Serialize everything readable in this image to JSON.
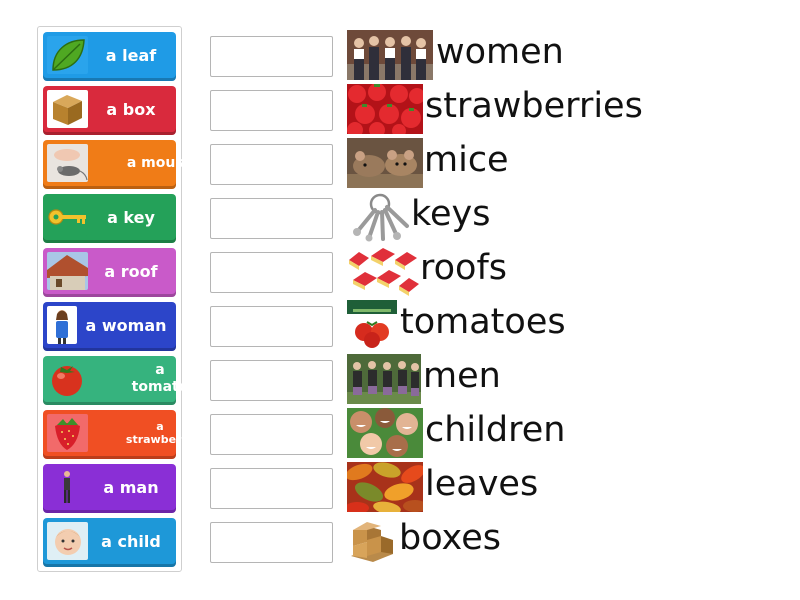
{
  "tiles": [
    {
      "label": "a leaf",
      "color": "#1f9be6",
      "icon": "leaf-icon"
    },
    {
      "label": "a box",
      "color": "#d92a3d",
      "icon": "box-icon"
    },
    {
      "label": "a mouse",
      "color": "#f07c17",
      "icon": "mouse-icon"
    },
    {
      "label": "a key",
      "color": "#24a159",
      "icon": "key-icon"
    },
    {
      "label": "a roof",
      "color": "#c95ac9",
      "icon": "roof-icon"
    },
    {
      "label": "a woman",
      "color": "#2c45c9",
      "icon": "woman-icon"
    },
    {
      "label": "a tomato",
      "color": "#36b37e",
      "icon": "tomato-icon"
    },
    {
      "label": "a strawberry",
      "color": "#f04f23",
      "icon": "strawberry-icon"
    },
    {
      "label": "a man",
      "color": "#8a2fd6",
      "icon": "man-icon"
    },
    {
      "label": "a child",
      "color": "#1e98d8",
      "icon": "child-icon"
    }
  ],
  "targets": [
    {
      "word": "women",
      "image": "women-photo"
    },
    {
      "word": "strawberries",
      "image": "strawberries-photo"
    },
    {
      "word": "mice",
      "image": "mice-photo"
    },
    {
      "word": "keys",
      "image": "keys-photo"
    },
    {
      "word": "roofs",
      "image": "roofs-photo"
    },
    {
      "word": "tomatoes",
      "image": "tomatoes-photo"
    },
    {
      "word": "men",
      "image": "men-photo"
    },
    {
      "word": "children",
      "image": "children-photo"
    },
    {
      "word": "leaves",
      "image": "leaves-photo"
    },
    {
      "word": "boxes",
      "image": "boxes-photo"
    }
  ]
}
